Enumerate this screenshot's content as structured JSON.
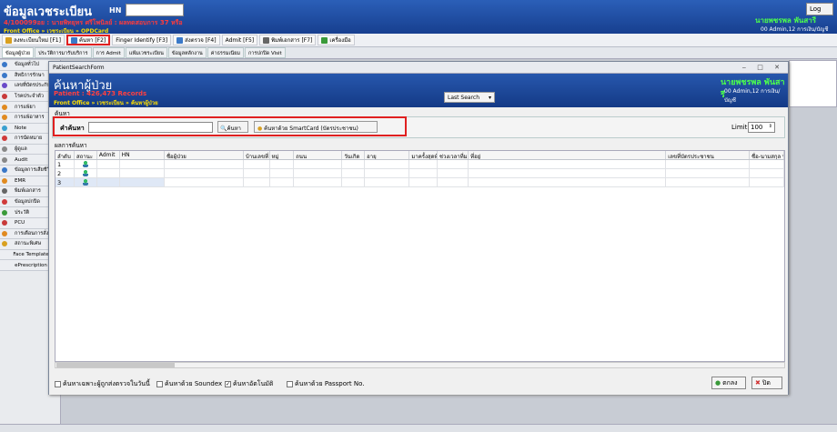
{
  "app": {
    "title": "ข้อมูลเวชระเบียน",
    "hn_label": "HN",
    "red_line": "4/100099อย : นายพิทยุทร ศรีโพนิลย์ : ผลทดสอบการ 37 หรือ",
    "breadcrumb": "Front Office » เวชระเบียน » OPDCard",
    "log_label": "Log",
    "user_name": "นายพชรพล พันสารี",
    "user_dept": "00 Admin,12 การเงิน/บัญชี"
  },
  "toolbar": [
    {
      "label": "ลงทะเบียนใหม่ [F1]",
      "highlight": false,
      "color": "#d9a020"
    },
    {
      "label": "ค้นหา [F2]",
      "highlight": true,
      "color": "#3a78c8"
    },
    {
      "label": "Finger Identify [F3]",
      "highlight": false,
      "color": ""
    },
    {
      "label": "ส่งตรวจ [F4]",
      "highlight": false,
      "color": "#3a78c8"
    },
    {
      "label": "Admit [F5]",
      "highlight": false,
      "color": ""
    },
    {
      "label": "พิมพ์เอกสาร [F7]",
      "highlight": false,
      "color": "#666666"
    },
    {
      "label": "เครื่องมือ",
      "highlight": false,
      "color": "#3a9a3a"
    }
  ],
  "tabs": [
    "ข้อมูลผู้ป่วย",
    "ประวัติการมารับบริการ",
    "การ Admit",
    "แฟ้มเวชระเบียน",
    "ข้อมูลหลักงาน",
    "ค่าธรรมเนียม",
    "การปกปิด Visit"
  ],
  "sidebar": [
    {
      "label": "ข้อมูลทั่วไป",
      "color": "#3a78c8"
    },
    {
      "label": "สิทธิการรักษา",
      "color": "#3a78c8"
    },
    {
      "label": "เลขที่บัตรประกัน",
      "color": "#6a4ac8"
    },
    {
      "label": "โรคประจำตัว",
      "color": "#c83a3a"
    },
    {
      "label": "การแพ้ยา",
      "color": "#e08a20"
    },
    {
      "label": "การแพ้อาหาร",
      "color": "#e08a20"
    },
    {
      "label": "Note",
      "color": "#3aa0d0"
    },
    {
      "label": "การนัดหมาย",
      "color": "#d03a3a"
    },
    {
      "label": "ผู้ดูแล",
      "color": "#888888"
    },
    {
      "label": "Audit",
      "color": "#888888"
    },
    {
      "label": "ข้อมูลการเสียชีวิต",
      "color": "#3a78c8"
    },
    {
      "label": "EMR",
      "color": "#e08a20"
    },
    {
      "label": "พิมพ์เอกสาร",
      "color": "#666666"
    },
    {
      "label": "ข้อมูลปกปิด",
      "color": "#d03a3a"
    },
    {
      "label": "ประวัติ",
      "color": "#3a9a3a"
    },
    {
      "label": "PCU",
      "color": "#c83a3a"
    },
    {
      "label": "การเตือนการสั่ง",
      "color": "#e08a20"
    },
    {
      "label": "สถานะพิเศษ",
      "color": "#d8a020"
    },
    {
      "label": "Face Template",
      "color": ""
    },
    {
      "label": "ePrescription",
      "color": ""
    }
  ],
  "dialog": {
    "window_title": "PatientSearchForm",
    "title": "ค้นหาผู้ป่วย",
    "patient_count": "Patient : 426,473 Records",
    "breadcrumb": "Front Office » เวชระเบียน » ค้นหาผู้ป่วย",
    "last_search": "Last Search",
    "user_name": "นายพชรพล พันสารี",
    "user_dept": "00 Admin,12 การเงิน/บัญชี",
    "search_group": "ค้นหา",
    "keyword_label": "คำค้นหา",
    "keyword_value": "",
    "search_button": "ค้นหา",
    "smartcard_button": "ค้นหาด้วย SmartCard (บัตรประชาชน)",
    "limit_label": "Limit",
    "limit_value": "100",
    "results_group": "ผลการค้นหา",
    "columns": [
      "ลำดับ",
      "สถานะ",
      "Admit",
      "HN",
      "ชื่อผู้ป่วย",
      "บ้านเลขที่",
      "หมู่",
      "ถนน",
      "วันเกิด",
      "อายุ",
      "มาครั้งสุดท้าย",
      "ช่วงเวลาที่มา",
      "ที่อยู่",
      "เลขที่บัตรประชาชน",
      "ชื่อ-นามสกุล บิดา"
    ],
    "rows": [
      {
        "no": "1"
      },
      {
        "no": "2"
      },
      {
        "no": "3"
      }
    ],
    "checks": [
      {
        "label": "ค้นหาเฉพาะผู้ถูกส่งตรวจในวันนี้",
        "checked": false
      },
      {
        "label": "ค้นหาด้วย Soundex",
        "checked": false
      },
      {
        "label": "ค้นหาอัตโนมัติ",
        "checked": true
      },
      {
        "label": "ค้นหาด้วย Passport No.",
        "checked": false
      }
    ],
    "ok_button": "ตกลง",
    "close_button": "ปิด"
  }
}
